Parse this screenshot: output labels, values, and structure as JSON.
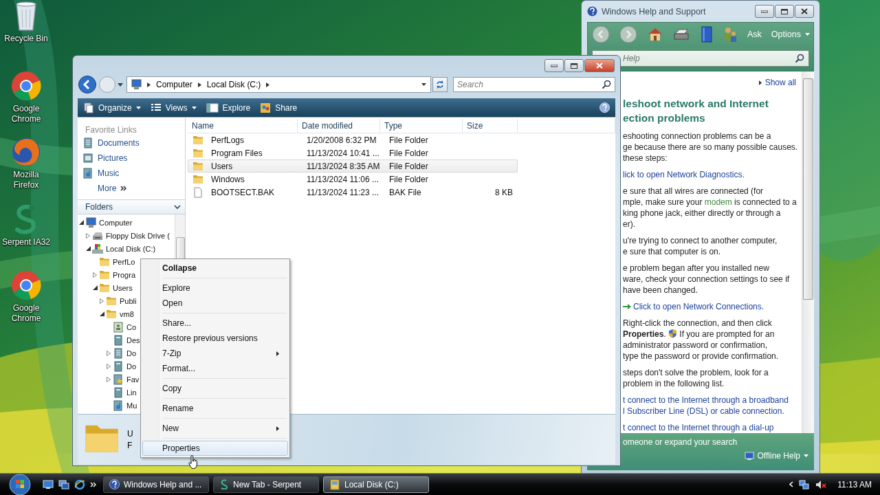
{
  "desktop_icons": [
    {
      "label": "Recycle Bin",
      "kind": "recycle"
    },
    {
      "label": "Google Chrome",
      "kind": "chrome"
    },
    {
      "label": "Mozilla Firefox",
      "kind": "firefox"
    },
    {
      "label": "Serpent IA32",
      "kind": "serpent"
    },
    {
      "label": "Google Chrome",
      "kind": "chrome"
    }
  ],
  "help_window": {
    "title": "Windows Help and Support",
    "toolbar": {
      "ask": "Ask",
      "options": "Options"
    },
    "search": {
      "placeholder": "Help"
    },
    "show_all": "Show all",
    "heading": [
      "leshoot network and Internet",
      "ection problems"
    ],
    "blocks": [
      {
        "kind": "para",
        "lines": [
          "eshooting connection problems can be a",
          "ge because there are so many possible causes.",
          "these steps:"
        ]
      },
      {
        "kind": "link",
        "lines": [
          "lick to open Network Diagnostics."
        ]
      },
      {
        "kind": "para",
        "lines": [
          "e sure that all wires are connected (for",
          [
            {
              "kind": "text",
              "text": "mple, make sure your"
            },
            {
              "kind": "term",
              "text": "modem"
            },
            {
              "kind": "text",
              "text": "is connected to a"
            }
          ],
          "king phone jack, either directly or through a",
          "er)."
        ]
      },
      {
        "kind": "para",
        "lines": [
          "u're trying to connect to another computer,",
          "e sure that computer is on."
        ]
      },
      {
        "kind": "para",
        "lines": [
          "e problem began after you installed new",
          "ware, check your connection settings to see if",
          "have been changed."
        ]
      },
      {
        "kind": "action",
        "lines": [
          "Click to open Network Connections."
        ]
      },
      {
        "kind": "para",
        "lines": [
          "Right-click the connection, and then click",
          [
            {
              "kind": "text",
              "text": "**Properties**."
            },
            {
              "kind": "shield"
            },
            {
              "kind": "text",
              "text": "If you are prompted for an"
            }
          ],
          "administrator password or confirmation,",
          "type the password or provide confirmation."
        ]
      },
      {
        "kind": "para",
        "lines": [
          "steps don't solve the problem, look for a",
          "problem in the following list."
        ]
      },
      {
        "kind": "link",
        "lines": [
          "t connect to the Internet through a broadband",
          "l Subscriber Line (DSL) or cable connection."
        ]
      },
      {
        "kind": "link",
        "lines": [
          "t connect to the Internet through a dial-up"
        ]
      }
    ],
    "footer": {
      "text": "omeone or expand your search",
      "offline": "Offline Help"
    }
  },
  "explorer": {
    "breadcrumb": [
      "Computer",
      "Local Disk (C:)"
    ],
    "search": {
      "placeholder": "Search"
    },
    "toolbar": [
      {
        "label": "Organize",
        "kind": "organize",
        "menu": true
      },
      {
        "label": "Views",
        "kind": "views",
        "menu": true
      },
      {
        "label": "Explore",
        "kind": "explore",
        "menu": false
      },
      {
        "label": "Share",
        "kind": "share",
        "menu": false
      }
    ],
    "favorite_links": {
      "title": "Favorite Links",
      "items": [
        {
          "label": "Documents",
          "kind": "documents"
        },
        {
          "label": "Pictures",
          "kind": "pictures"
        },
        {
          "label": "Music",
          "kind": "music"
        },
        {
          "label": "More",
          "kind": "more"
        }
      ]
    },
    "folders": {
      "title": "Folders",
      "tree": [
        {
          "label": "Computer",
          "kind": "computer",
          "expandable": true,
          "expanded": true,
          "children": [
            {
              "label": "Floppy Disk Drive (",
              "kind": "floppy",
              "expandable": true,
              "expanded": false
            },
            {
              "label": "Local Disk (C:)",
              "kind": "disk",
              "expandable": true,
              "expanded": true,
              "children": [
                {
                  "label": "PerfLo",
                  "kind": "folder",
                  "expandable": false
                },
                {
                  "label": "Progra",
                  "kind": "folder",
                  "expandable": true,
                  "expanded": false
                },
                {
                  "label": "Users",
                  "kind": "folder",
                  "expandable": true,
                  "expanded": true,
                  "children": [
                    {
                      "label": "Publi",
                      "kind": "folder",
                      "expandable": true,
                      "expanded": false
                    },
                    {
                      "label": "vm8",
                      "kind": "folder",
                      "expandable": true,
                      "expanded": true,
                      "children": [
                        {
                          "label": "Co",
                          "kind": "contacts",
                          "expandable": false
                        },
                        {
                          "label": "Des",
                          "kind": "library",
                          "expandable": false
                        },
                        {
                          "label": "Do",
                          "kind": "documents",
                          "expandable": true,
                          "expanded": false
                        },
                        {
                          "label": "Do",
                          "kind": "library",
                          "expandable": true,
                          "expanded": false
                        },
                        {
                          "label": "Fav",
                          "kind": "favorites",
                          "expandable": true,
                          "expanded": false
                        },
                        {
                          "label": "Lin",
                          "kind": "library",
                          "expandable": false
                        },
                        {
                          "label": "Mu",
                          "kind": "music",
                          "expandable": false
                        }
                      ]
                    }
                  ]
                }
              ]
            }
          ]
        }
      ]
    },
    "table": {
      "columns": [
        "Name",
        "Date modified",
        "Type",
        "Size"
      ],
      "rows": [
        {
          "kind": "folder",
          "selected": false,
          "cells": [
            "PerfLogs",
            "1/20/2008 6:32 PM",
            "File Folder",
            ""
          ]
        },
        {
          "kind": "folder",
          "selected": false,
          "cells": [
            "Program Files",
            "11/13/2024 10:41 ...",
            "File Folder",
            ""
          ]
        },
        {
          "kind": "folder",
          "selected": true,
          "cells": [
            "Users",
            "11/13/2024 8:35 AM",
            "File Folder",
            ""
          ]
        },
        {
          "kind": "folder",
          "selected": false,
          "cells": [
            "Windows",
            "11/13/2024 11:06 ...",
            "File Folder",
            ""
          ]
        },
        {
          "kind": "file",
          "selected": false,
          "cells": [
            "BOOTSECT.BAK",
            "11/13/2024 11:23 ...",
            "BAK File",
            "8 KB"
          ]
        }
      ]
    },
    "details": [
      "U",
      "F"
    ]
  },
  "context_menu": [
    {
      "kind": "item",
      "label": "Collapse",
      "bold": true,
      "submenu": false,
      "selected": false
    },
    {
      "kind": "separator"
    },
    {
      "kind": "item",
      "label": "Explore",
      "bold": false,
      "submenu": false,
      "selected": false
    },
    {
      "kind": "item",
      "label": "Open",
      "bold": false,
      "submenu": false,
      "selected": false
    },
    {
      "kind": "separator"
    },
    {
      "kind": "item",
      "label": "Share...",
      "bold": false,
      "submenu": false,
      "selected": false
    },
    {
      "kind": "item",
      "label": "Restore previous versions",
      "bold": false,
      "submenu": false,
      "selected": false
    },
    {
      "kind": "item",
      "label": "7-Zip",
      "bold": false,
      "submenu": true,
      "selected": false
    },
    {
      "kind": "item",
      "label": "Format...",
      "bold": false,
      "submenu": false,
      "selected": false
    },
    {
      "kind": "separator"
    },
    {
      "kind": "item",
      "label": "Copy",
      "bold": false,
      "submenu": false,
      "selected": false
    },
    {
      "kind": "separator"
    },
    {
      "kind": "item",
      "label": "Rename",
      "bold": false,
      "submenu": false,
      "selected": false
    },
    {
      "kind": "separator"
    },
    {
      "kind": "item",
      "label": "New",
      "bold": false,
      "submenu": true,
      "selected": false
    },
    {
      "kind": "separator"
    },
    {
      "kind": "item",
      "label": "Properties",
      "bold": false,
      "submenu": false,
      "selected": true
    }
  ],
  "taskbar": {
    "buttons": [
      {
        "label": "Windows Help and ...",
        "kind": "help",
        "active": false
      },
      {
        "label": "New Tab - Serpent",
        "kind": "serpent",
        "active": false
      },
      {
        "label": "Local Disk (C:)",
        "kind": "explorer",
        "active": true
      }
    ],
    "clock": "11:13 AM"
  }
}
